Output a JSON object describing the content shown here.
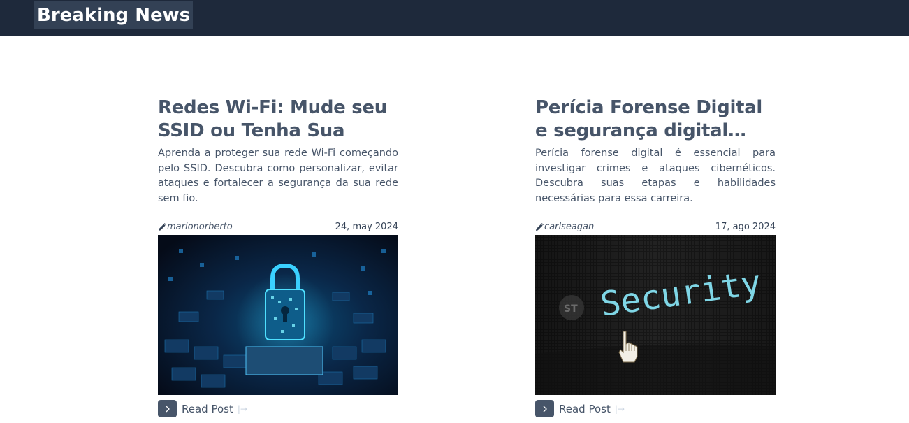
{
  "header": {
    "brand": "Breaking News",
    "bg_color": "#1e293b",
    "brand_bg_color": "#334155"
  },
  "posts": [
    {
      "title": "Redes Wi-Fi: Mude seu SSID ou Tenha Sua Rede",
      "excerpt": "Aprenda a proteger sua rede Wi-Fi começando pelo SSID. Descubra como personalizar, evitar ataques e fortalecer a segurança da sua rede sem fio.",
      "author": "marionorberto",
      "date": "24, may 2024",
      "image_icon": "padlock-circuit-image",
      "read_label": "Read Post"
    },
    {
      "title": "Perícia Forense Digital e segurança digital…",
      "excerpt": "Perícia forense digital é essencial para investigar crimes e ataques cibernéticos. Descubra suas etapas e habilidades necessárias para essa carreira.",
      "author": "carlseagan",
      "date": "17, ago 2024",
      "image_icon": "security-screen-image",
      "image_text": "Security",
      "read_label": "Read Post"
    }
  ],
  "colors": {
    "text": "#475569",
    "button": "#475569"
  }
}
